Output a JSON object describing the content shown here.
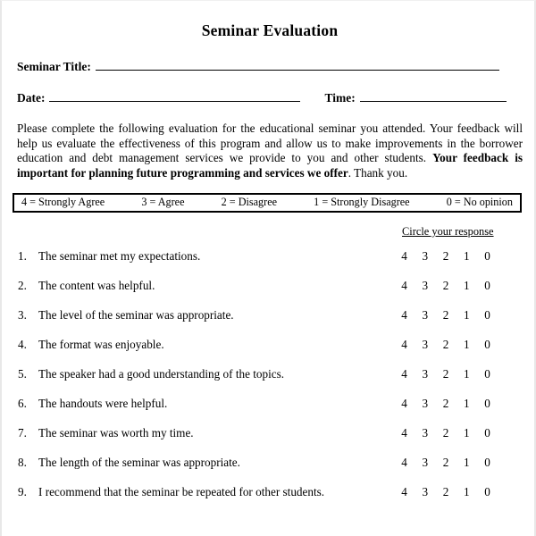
{
  "document": {
    "title": "Seminar Evaluation",
    "fields": [
      {
        "label": "Seminar Title:",
        "value": ""
      },
      {
        "label": "Date:",
        "value": ""
      },
      {
        "label": "Time:",
        "value": ""
      }
    ],
    "intro": {
      "part1": "Please complete the following evaluation for the educational seminar you attended.  Your feedback will help us evaluate the effectiveness of this program and allow us to make improvements in the borrower education and debt management services we provide to you and other students. ",
      "bold": "Your feedback is important for planning future programming and services we offer",
      "part2": ".  Thank you."
    },
    "scale": [
      "4 = Strongly Agree",
      "3 = Agree",
      "2 = Disagree",
      "1 = Strongly Disagree",
      "0 = No opinion"
    ],
    "response_header": "Circle your response",
    "response_options": [
      "4",
      "3",
      "2",
      "1",
      "0"
    ],
    "questions": [
      {
        "num": "1.",
        "text": "The seminar met my expectations."
      },
      {
        "num": "2.",
        "text": "The content was helpful."
      },
      {
        "num": "3.",
        "text": "The level of the seminar was appropriate."
      },
      {
        "num": "4.",
        "text": "The format was enjoyable."
      },
      {
        "num": "5.",
        "text": "The speaker had a good understanding of the topics."
      },
      {
        "num": "6.",
        "text": "The handouts were helpful."
      },
      {
        "num": "7.",
        "text": "The seminar was worth my time."
      },
      {
        "num": "8.",
        "text": "The length of the seminar was appropriate."
      },
      {
        "num": "9.",
        "text": "I recommend that the seminar be repeated for other students."
      }
    ]
  }
}
